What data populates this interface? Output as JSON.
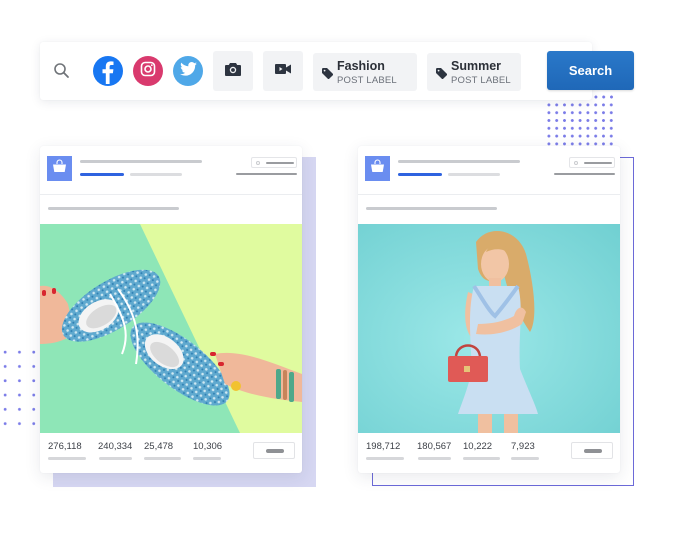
{
  "search_bar": {
    "search_icon": "search-icon",
    "social_networks": [
      {
        "name": "Facebook",
        "icon": "facebook-icon",
        "color": "#1877f2"
      },
      {
        "name": "Instagram",
        "icon": "instagram-icon",
        "color": "#d93a6e"
      },
      {
        "name": "Twitter",
        "icon": "twitter-icon",
        "color": "#4fa8e8"
      }
    ],
    "media_filters": [
      {
        "name": "Photo",
        "icon": "camera-icon"
      },
      {
        "name": "Video",
        "icon": "video-icon"
      }
    ],
    "tags": [
      {
        "title": "Fashion",
        "subtitle": "POST LABEL",
        "icon": "tag-icon"
      },
      {
        "title": "Summer",
        "subtitle": "POST LABEL",
        "icon": "tag-icon"
      }
    ],
    "search_button_label": "Search"
  },
  "colors": {
    "accent_blue": "#2f63e0",
    "search_button": "#2272c2",
    "logo_blue": "#6a8df0",
    "dots_purple": "#7b7ce8",
    "backdrop_lavender": "#d6d7f2",
    "outline_purple": "#6c6ad8"
  },
  "posts": [
    {
      "image_description": "Hands holding blue patterned sneakers on green and yellow background",
      "stats": [
        "276,118",
        "240,334",
        "25,478",
        "10,306"
      ]
    },
    {
      "image_description": "Blonde woman in light blue ruffled dress holding a coral handbag on turquoise background",
      "stats": [
        "198,712",
        "180,567",
        "10,222",
        "7,923"
      ]
    }
  ]
}
